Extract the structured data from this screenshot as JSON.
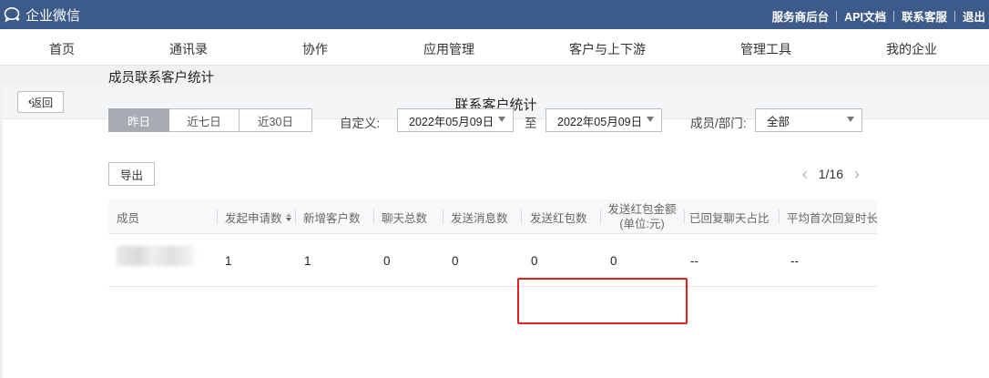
{
  "topbar": {
    "brand": "企业微信",
    "links": [
      "服务商后台",
      "API文档",
      "联系客服",
      "退出"
    ]
  },
  "nav": {
    "items": [
      "首页",
      "通讯录",
      "协作",
      "应用管理",
      "客户与上下游",
      "管理工具",
      "我的企业"
    ],
    "active_index": 4
  },
  "panel": {
    "back_label": "返回",
    "title": "联系客户统计",
    "section_title": "成员联系客户统计"
  },
  "filters": {
    "ranges": [
      "昨日",
      "近七日",
      "近30日"
    ],
    "active_range": 0,
    "custom_label": "自定义:",
    "start_date": "2022年05月09日",
    "to_label": "至",
    "end_date": "2022年05月09日",
    "member_label": "成员/部门:",
    "member_value": "全部"
  },
  "toolbar": {
    "export_label": "导出",
    "page_indicator": "1/16"
  },
  "table": {
    "headers": [
      "成员",
      "发起申请数",
      "新增客户数",
      "聊天总数",
      "发送消息数",
      "发送红包数",
      "发送红包金额",
      "已回复聊天占比",
      "平均首次回复时长"
    ],
    "amount_unit": "(单位:元)",
    "rows": [
      {
        "member": "",
        "applications": "1",
        "new_customers": "1",
        "chats": "0",
        "messages": "0",
        "red_packets": "0",
        "red_packet_amount": "0",
        "reply_ratio": "--",
        "avg_first_reply": "--"
      }
    ]
  },
  "colors": {
    "topbar": "#3c5a8a",
    "highlight": "#e02020",
    "active_segment": "#a7abb2"
  }
}
